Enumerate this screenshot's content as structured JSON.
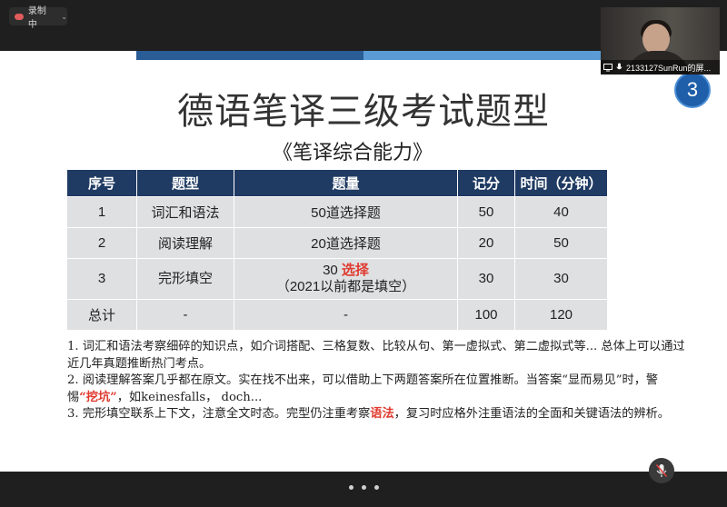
{
  "recording": {
    "label": "录制中"
  },
  "slide": {
    "page_number": "3",
    "title": "德语笔译三级考试题型",
    "subtitle": "《笔译综合能力》",
    "table": {
      "headers": [
        "序号",
        "题型",
        "题量",
        "记分",
        "时间（分钟）"
      ],
      "rows": [
        {
          "no": "1",
          "type": "词汇和语法",
          "amount": "50道选择题",
          "score": "50",
          "time": "40"
        },
        {
          "no": "2",
          "type": "阅读理解",
          "amount": "20道选择题",
          "score": "20",
          "time": "50"
        },
        {
          "no": "3",
          "type": "完形填空",
          "amount_num": "30",
          "amount_red": "选择",
          "amount_note": "（2021以前都是填空）",
          "score": "30",
          "time": "30"
        },
        {
          "no": "总计",
          "type": "-",
          "amount": "-",
          "score": "100",
          "time": "120"
        }
      ]
    },
    "notes": {
      "n1": "1. 词汇和语法考察细碎的知识点，如介词搭配、三格复数、比较从句、第一虚拟式、第二虚拟式等... 总体上可以通过近几年真题推断热门考点。",
      "n2a": "2. 阅读理解答案几乎都在原文。实在找不出来，可以借助上下两题答案所在位置推断。当答案“显而易见”时，警惕",
      "n2red": "“挖坑”",
      "n2b": "，如keinesfalls， doch...",
      "n3a": "3. 完形填空联系上下文，注意全文时态。完型仍注重考察",
      "n3red": "语法",
      "n3b": "，复习时应格外注重语法的全面和关键语法的辨析。"
    }
  },
  "participant": {
    "name": "2133127SunRun的屏..."
  },
  "colors": {
    "header_bg": "#1f3b63",
    "cell_bg": "#dfe0e2",
    "accent_red": "#e03a2f",
    "bar_dark": "#2a5c96",
    "bar_light": "#5b9bd5"
  }
}
